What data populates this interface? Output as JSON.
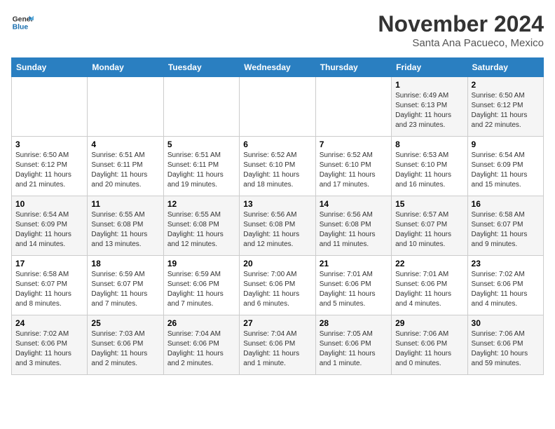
{
  "logo": {
    "line1": "General",
    "line2": "Blue"
  },
  "title": "November 2024",
  "location": "Santa Ana Pacueco, Mexico",
  "weekdays": [
    "Sunday",
    "Monday",
    "Tuesday",
    "Wednesday",
    "Thursday",
    "Friday",
    "Saturday"
  ],
  "weeks": [
    [
      {
        "day": "",
        "info": ""
      },
      {
        "day": "",
        "info": ""
      },
      {
        "day": "",
        "info": ""
      },
      {
        "day": "",
        "info": ""
      },
      {
        "day": "",
        "info": ""
      },
      {
        "day": "1",
        "info": "Sunrise: 6:49 AM\nSunset: 6:13 PM\nDaylight: 11 hours\nand 23 minutes."
      },
      {
        "day": "2",
        "info": "Sunrise: 6:50 AM\nSunset: 6:12 PM\nDaylight: 11 hours\nand 22 minutes."
      }
    ],
    [
      {
        "day": "3",
        "info": "Sunrise: 6:50 AM\nSunset: 6:12 PM\nDaylight: 11 hours\nand 21 minutes."
      },
      {
        "day": "4",
        "info": "Sunrise: 6:51 AM\nSunset: 6:11 PM\nDaylight: 11 hours\nand 20 minutes."
      },
      {
        "day": "5",
        "info": "Sunrise: 6:51 AM\nSunset: 6:11 PM\nDaylight: 11 hours\nand 19 minutes."
      },
      {
        "day": "6",
        "info": "Sunrise: 6:52 AM\nSunset: 6:10 PM\nDaylight: 11 hours\nand 18 minutes."
      },
      {
        "day": "7",
        "info": "Sunrise: 6:52 AM\nSunset: 6:10 PM\nDaylight: 11 hours\nand 17 minutes."
      },
      {
        "day": "8",
        "info": "Sunrise: 6:53 AM\nSunset: 6:10 PM\nDaylight: 11 hours\nand 16 minutes."
      },
      {
        "day": "9",
        "info": "Sunrise: 6:54 AM\nSunset: 6:09 PM\nDaylight: 11 hours\nand 15 minutes."
      }
    ],
    [
      {
        "day": "10",
        "info": "Sunrise: 6:54 AM\nSunset: 6:09 PM\nDaylight: 11 hours\nand 14 minutes."
      },
      {
        "day": "11",
        "info": "Sunrise: 6:55 AM\nSunset: 6:08 PM\nDaylight: 11 hours\nand 13 minutes."
      },
      {
        "day": "12",
        "info": "Sunrise: 6:55 AM\nSunset: 6:08 PM\nDaylight: 11 hours\nand 12 minutes."
      },
      {
        "day": "13",
        "info": "Sunrise: 6:56 AM\nSunset: 6:08 PM\nDaylight: 11 hours\nand 12 minutes."
      },
      {
        "day": "14",
        "info": "Sunrise: 6:56 AM\nSunset: 6:08 PM\nDaylight: 11 hours\nand 11 minutes."
      },
      {
        "day": "15",
        "info": "Sunrise: 6:57 AM\nSunset: 6:07 PM\nDaylight: 11 hours\nand 10 minutes."
      },
      {
        "day": "16",
        "info": "Sunrise: 6:58 AM\nSunset: 6:07 PM\nDaylight: 11 hours\nand 9 minutes."
      }
    ],
    [
      {
        "day": "17",
        "info": "Sunrise: 6:58 AM\nSunset: 6:07 PM\nDaylight: 11 hours\nand 8 minutes."
      },
      {
        "day": "18",
        "info": "Sunrise: 6:59 AM\nSunset: 6:07 PM\nDaylight: 11 hours\nand 7 minutes."
      },
      {
        "day": "19",
        "info": "Sunrise: 6:59 AM\nSunset: 6:06 PM\nDaylight: 11 hours\nand 7 minutes."
      },
      {
        "day": "20",
        "info": "Sunrise: 7:00 AM\nSunset: 6:06 PM\nDaylight: 11 hours\nand 6 minutes."
      },
      {
        "day": "21",
        "info": "Sunrise: 7:01 AM\nSunset: 6:06 PM\nDaylight: 11 hours\nand 5 minutes."
      },
      {
        "day": "22",
        "info": "Sunrise: 7:01 AM\nSunset: 6:06 PM\nDaylight: 11 hours\nand 4 minutes."
      },
      {
        "day": "23",
        "info": "Sunrise: 7:02 AM\nSunset: 6:06 PM\nDaylight: 11 hours\nand 4 minutes."
      }
    ],
    [
      {
        "day": "24",
        "info": "Sunrise: 7:02 AM\nSunset: 6:06 PM\nDaylight: 11 hours\nand 3 minutes."
      },
      {
        "day": "25",
        "info": "Sunrise: 7:03 AM\nSunset: 6:06 PM\nDaylight: 11 hours\nand 2 minutes."
      },
      {
        "day": "26",
        "info": "Sunrise: 7:04 AM\nSunset: 6:06 PM\nDaylight: 11 hours\nand 2 minutes."
      },
      {
        "day": "27",
        "info": "Sunrise: 7:04 AM\nSunset: 6:06 PM\nDaylight: 11 hours\nand 1 minute."
      },
      {
        "day": "28",
        "info": "Sunrise: 7:05 AM\nSunset: 6:06 PM\nDaylight: 11 hours\nand 1 minute."
      },
      {
        "day": "29",
        "info": "Sunrise: 7:06 AM\nSunset: 6:06 PM\nDaylight: 11 hours\nand 0 minutes."
      },
      {
        "day": "30",
        "info": "Sunrise: 7:06 AM\nSunset: 6:06 PM\nDaylight: 10 hours\nand 59 minutes."
      }
    ]
  ]
}
